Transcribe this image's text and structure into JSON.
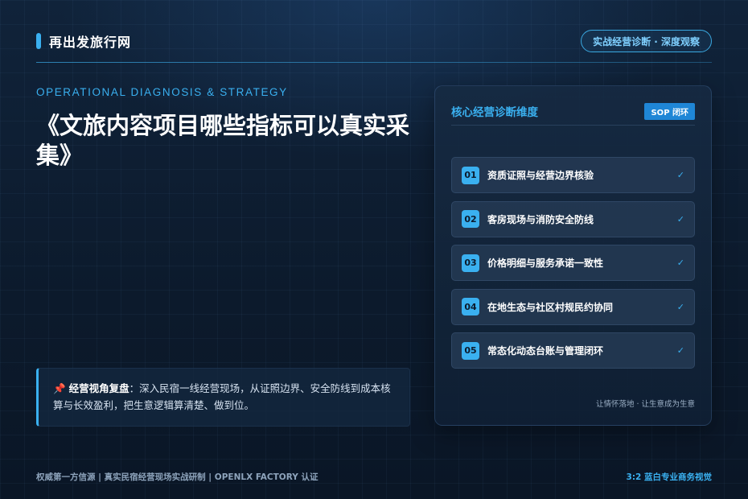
{
  "header": {
    "brand": "再出发旅行网",
    "tag": "实战经营诊断 · 深度观察"
  },
  "hero": {
    "eyebrow": "OPERATIONAL DIAGNOSIS & STRATEGY",
    "title": "《文旅内容项目哪些指标可以真实采集》"
  },
  "note": {
    "lead": "经营视角复盘",
    "text": "：深入民宿一线经营现场，从证照边界、安全防线到成本核算与长效盈利，把生意逻辑算清楚、做到位。"
  },
  "panel": {
    "title": "核心经营诊断维度",
    "badge": "SOP 闭环",
    "items": [
      {
        "num": "01",
        "label": "资质证照与经营边界核验",
        "check": "✓"
      },
      {
        "num": "02",
        "label": "客房现场与消防安全防线",
        "check": "✓"
      },
      {
        "num": "03",
        "label": "价格明细与服务承诺一致性",
        "check": "✓"
      },
      {
        "num": "04",
        "label": "在地生态与社区村规民约协同",
        "check": "✓"
      },
      {
        "num": "05",
        "label": "常态化动态台账与管理闭环",
        "check": "✓"
      }
    ],
    "footer": "让情怀落地 · 让生意成为生意"
  },
  "footer": {
    "left": "权威第一方信源  |  真实民宿经营现场实战研制  |  OPENLX FACTORY 认证",
    "right": "3:2 蓝白专业商务视觉"
  },
  "colors": {
    "accent": "#3ab0f0",
    "background": "#0c1a2c"
  }
}
